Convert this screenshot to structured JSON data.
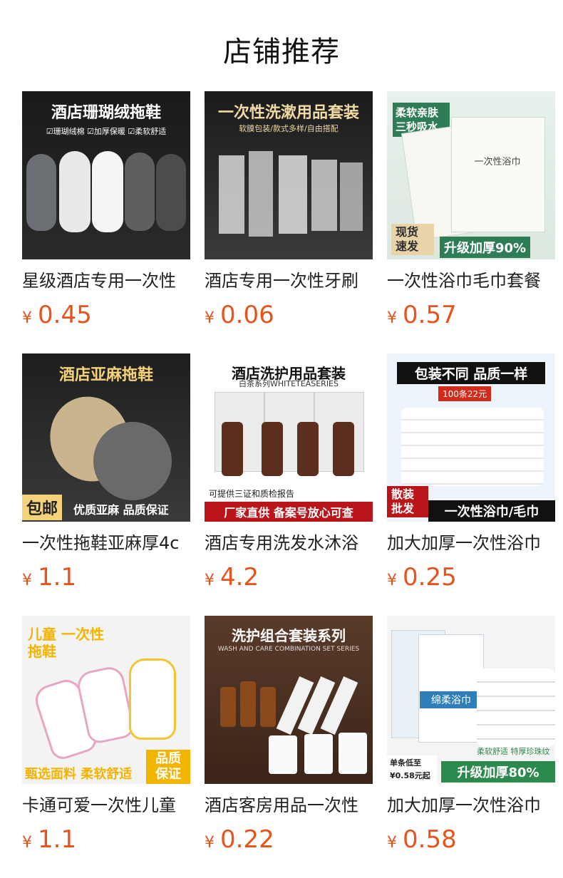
{
  "page": {
    "title": "店铺推荐"
  },
  "products": [
    {
      "name": "星级酒店专用一次性",
      "currency": "¥",
      "price": "0.45",
      "image": {
        "caption": "酒店珊瑚绒拖鞋",
        "sub": "☑珊瑚绒棉  ☑加厚保暖  ☑柔软舒适",
        "theme": "dark",
        "accent": "#ffffff"
      }
    },
    {
      "name": "酒店专用一次性牙刷",
      "currency": "¥",
      "price": "0.06",
      "image": {
        "caption": "一次性洗漱用品套装",
        "sub": "软膜包装/款式多样/自由搭配",
        "theme": "dark",
        "accent": "#f1d9a6"
      }
    },
    {
      "name": "一次性浴巾毛巾套餐",
      "currency": "¥",
      "price": "0.57",
      "image": {
        "caption": "柔软亲肤 三秒吸水",
        "sub": "一次性浴巾",
        "badge_left": "现货 速发",
        "badge_right": "升级加厚90%",
        "theme": "green",
        "accent": "#2f7d56"
      }
    },
    {
      "name": "一次性拖鞋亚麻厚4c",
      "currency": "¥",
      "price": "1.1",
      "image": {
        "caption": "酒店亚麻拖鞋",
        "badge_left": "包邮",
        "badge_right": "优质亚麻 品质保证",
        "theme": "dark",
        "accent": "#f4d27a"
      }
    },
    {
      "name": "酒店专用洗发水沐浴",
      "currency": "¥",
      "price": "4.2",
      "image": {
        "caption": "酒店洗护用品套装",
        "sub": "白茶系列WHITETEASERIES",
        "badge_top": "可提供三证和质检报告",
        "badge_right": "厂家直供 备案号放心可查",
        "theme": "white",
        "accent": "#b9151b"
      }
    },
    {
      "name": "加大加厚一次性浴巾",
      "currency": "¥",
      "price": "0.25",
      "image": {
        "caption": "包装不同 品质一样",
        "sub": "100条22元",
        "badge_left": "散装 批发",
        "badge_right": "一次性浴巾/毛巾",
        "theme": "blue",
        "accent": "#111111"
      }
    },
    {
      "name": "卡通可爱一次性儿童",
      "currency": "¥",
      "price": "1.1",
      "image": {
        "caption": "儿童 一次性拖鞋",
        "badge_left": "甄选面料 柔软舒适",
        "badge_right": "品质 保证",
        "theme": "light",
        "accent": "#f3b400"
      }
    },
    {
      "name": "酒店客房用品一次性",
      "currency": "¥",
      "price": "0.22",
      "image": {
        "caption": "洗护组合套装系列",
        "sub": "WASH AND CARE COMBINATION SET SERIES",
        "theme": "wood",
        "accent": "#ffffff"
      }
    },
    {
      "name": "加大加厚一次性浴巾",
      "currency": "¥",
      "price": "0.58",
      "image": {
        "caption": "绵柔浴巾",
        "sub": "柔软舒适 特厚珍珠纹",
        "badge_left": "单条低至 ¥0.58元起",
        "badge_right": "升级加厚80%",
        "theme": "light",
        "accent": "#2d8a4e"
      }
    }
  ]
}
